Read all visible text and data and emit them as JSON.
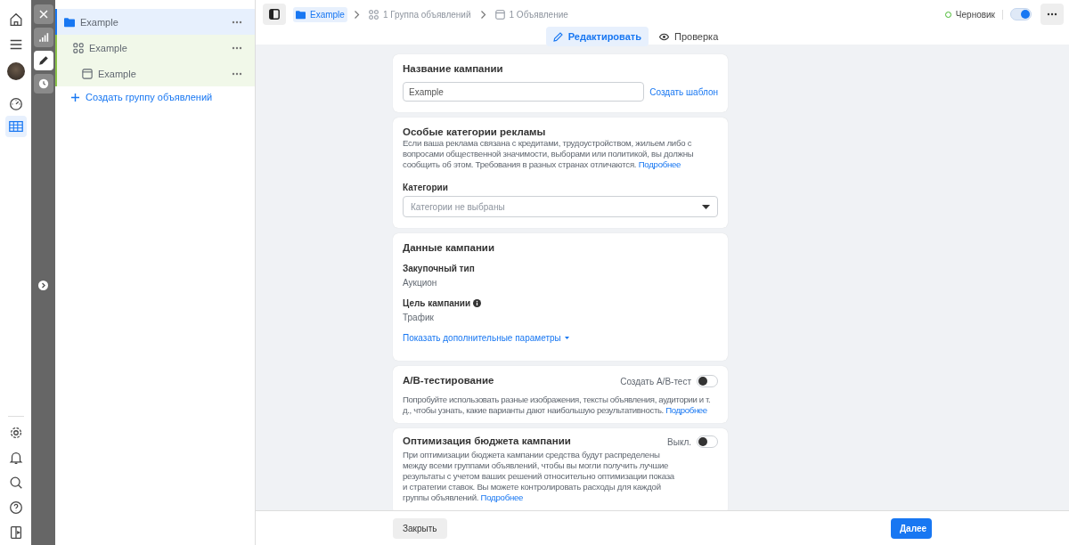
{
  "tools": [
    {
      "kind": "close",
      "selected": false
    },
    {
      "kind": "chart",
      "selected": false
    },
    {
      "kind": "edit",
      "selected": true
    },
    {
      "kind": "history",
      "selected": false
    }
  ],
  "tree": {
    "items": [
      {
        "label": "Example",
        "kind": "campaign",
        "selected": true,
        "children": [
          {
            "label": "Example",
            "kind": "adset",
            "selected": false,
            "children": [
              {
                "label": "Example",
                "kind": "ad",
                "selected": false
              }
            ]
          }
        ]
      }
    ],
    "create_link": "Создать группу объявлений"
  },
  "breadcrumbs": [
    {
      "label": "Example",
      "kind": "campaign",
      "selected": true
    },
    {
      "label": "1 Группа объявлений",
      "kind": "adset",
      "selected": false
    },
    {
      "label": "1 Объявление",
      "kind": "ad",
      "selected": false
    }
  ],
  "status": {
    "label": "Черновик",
    "on": true
  },
  "mode_tabs": [
    {
      "label": "Редактировать",
      "kind": "edit",
      "selected": true
    },
    {
      "label": "Проверка",
      "kind": "review",
      "selected": false
    }
  ],
  "cards": [
    {
      "kind": "name",
      "title": "Название кампании",
      "value": "Example",
      "link": "Создать шаблон"
    },
    {
      "kind": "special",
      "title": "Особые категории рекламы",
      "description": "Если ваша реклама связана с кредитами, трудоустройством, жильем либо с вопросами общественной значимости, выборами или политикой, вы должны сообщить об этом. Требования в разных странах отличаются.",
      "link": "Подробнее",
      "field_label": "Категории",
      "placeholder": "Категории не выбраны"
    },
    {
      "kind": "details",
      "title": "Данные кампании",
      "fields": [
        {
          "label": "Закупочный тип",
          "info": false,
          "value": "Аукцион"
        },
        {
          "label": "Цель кампании",
          "info": true,
          "value": "Трафик"
        }
      ],
      "link": "Показать дополнительные параметры"
    },
    {
      "kind": "toggle",
      "title": "A/B-тестирование",
      "toggle_label": "Создать A/B-тест",
      "on": false,
      "description": "Попробуйте использовать разные изображения, тексты объявления, аудитории и т. д., чтобы узнать, какие варианты дают наибольшую результативность.",
      "link": "Подробнее"
    },
    {
      "kind": "toggle",
      "title": "Оптимизация бюджета кампании",
      "toggle_label": "Выкл.",
      "on": false,
      "description": "При оптимизации бюджета кампании средства будут распределены между всеми группами объявлений, чтобы вы могли получить лучшие результаты с учетом ваших решений относительно оптимизации показа и стратегии ставок. Вы можете контролировать расходы для каждой группы объявлений.",
      "link": "Подробнее"
    }
  ],
  "footer": {
    "close": "Закрыть",
    "next": "Далее"
  }
}
